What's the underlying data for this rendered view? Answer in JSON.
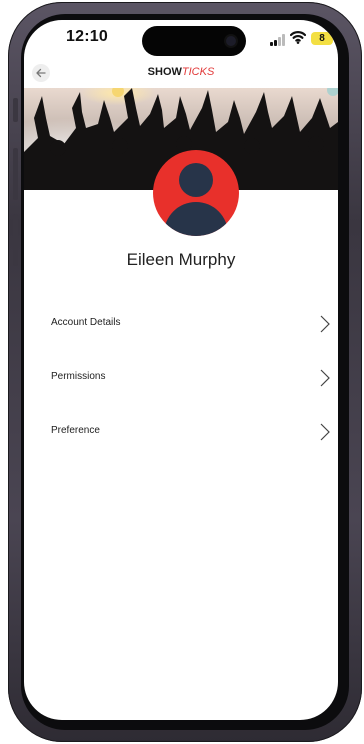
{
  "status_bar": {
    "time": "12:10",
    "battery": "8"
  },
  "header": {
    "logo_part1": "SHOW",
    "logo_part2": "TICKS"
  },
  "profile": {
    "name": "Eileen Murphy"
  },
  "menu": {
    "items": [
      {
        "label": "Account Details"
      },
      {
        "label": "Permissions"
      },
      {
        "label": "Preference"
      }
    ]
  },
  "colors": {
    "accent": "#e23a3a",
    "avatar_bg": "#e8302b",
    "avatar_figure": "#273449",
    "battery": "#f3df43"
  },
  "icons": [
    "back-arrow-icon",
    "signal-icon",
    "wifi-icon",
    "battery-icon",
    "chevron-right-icon",
    "avatar-icon"
  ]
}
